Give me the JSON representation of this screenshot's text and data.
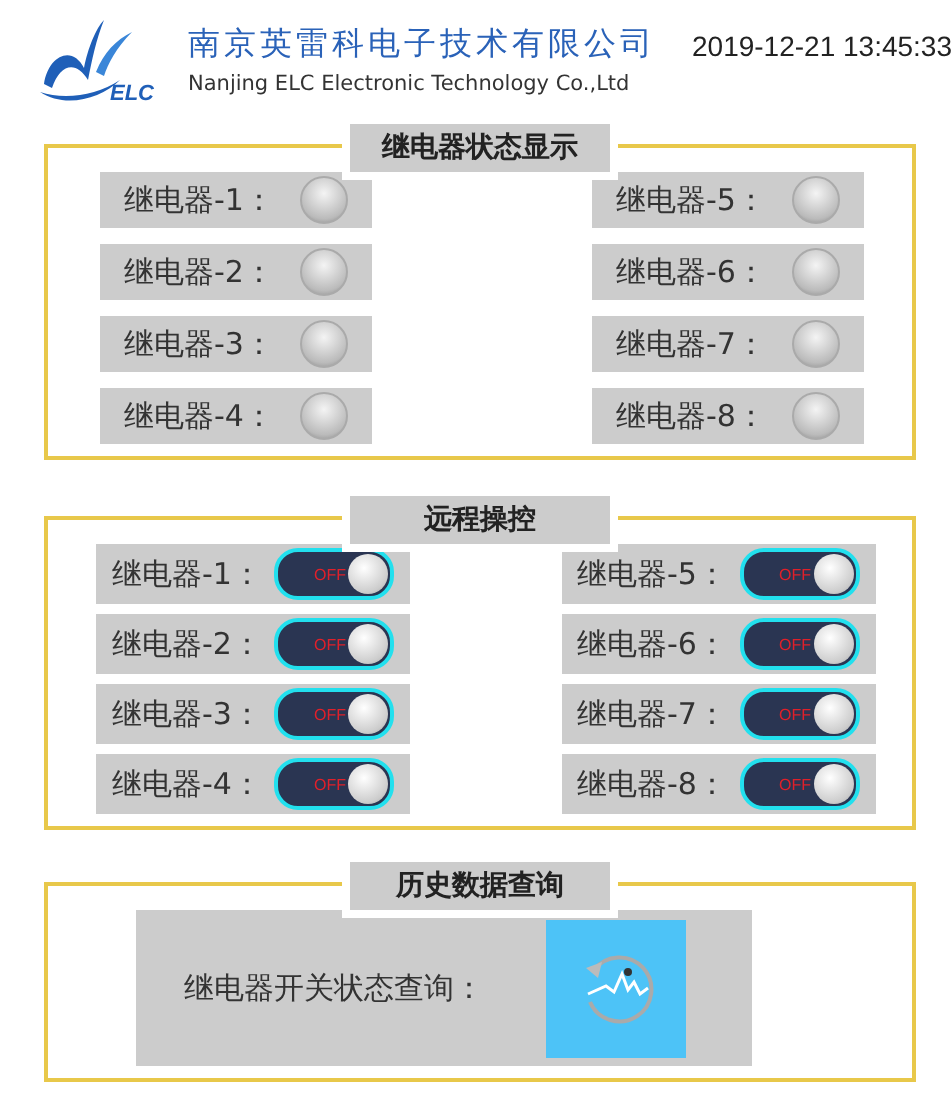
{
  "header": {
    "logo_text": "ELC",
    "company_name": "南京英雷科电子技术有限公司",
    "company_name_en": "Nanjing ELC Electronic Technology Co.,Ltd",
    "datetime": "2019-12-21 13:45:33"
  },
  "relay_status": {
    "title": "继电器状态显示",
    "relays": [
      {
        "label": "继电器-1：",
        "on": false
      },
      {
        "label": "继电器-5：",
        "on": false
      },
      {
        "label": "继电器-2：",
        "on": false
      },
      {
        "label": "继电器-6：",
        "on": false
      },
      {
        "label": "继电器-3：",
        "on": false
      },
      {
        "label": "继电器-7：",
        "on": false
      },
      {
        "label": "继电器-4：",
        "on": false
      },
      {
        "label": "继电器-8：",
        "on": false
      }
    ]
  },
  "remote_control": {
    "title": "远程操控",
    "switches": [
      {
        "label": "继电器-1：",
        "on": false,
        "state_text": "OFF"
      },
      {
        "label": "继电器-5：",
        "on": false,
        "state_text": "OFF"
      },
      {
        "label": "继电器-2：",
        "on": false,
        "state_text": "OFF"
      },
      {
        "label": "继电器-6：",
        "on": false,
        "state_text": "OFF"
      },
      {
        "label": "继电器-3：",
        "on": false,
        "state_text": "OFF"
      },
      {
        "label": "继电器-7：",
        "on": false,
        "state_text": "OFF"
      },
      {
        "label": "继电器-4：",
        "on": false,
        "state_text": "OFF"
      },
      {
        "label": "继电器-8：",
        "on": false,
        "state_text": "OFF"
      }
    ]
  },
  "history": {
    "title": "历史数据查询",
    "query_label": "继电器开关状态查询："
  }
}
